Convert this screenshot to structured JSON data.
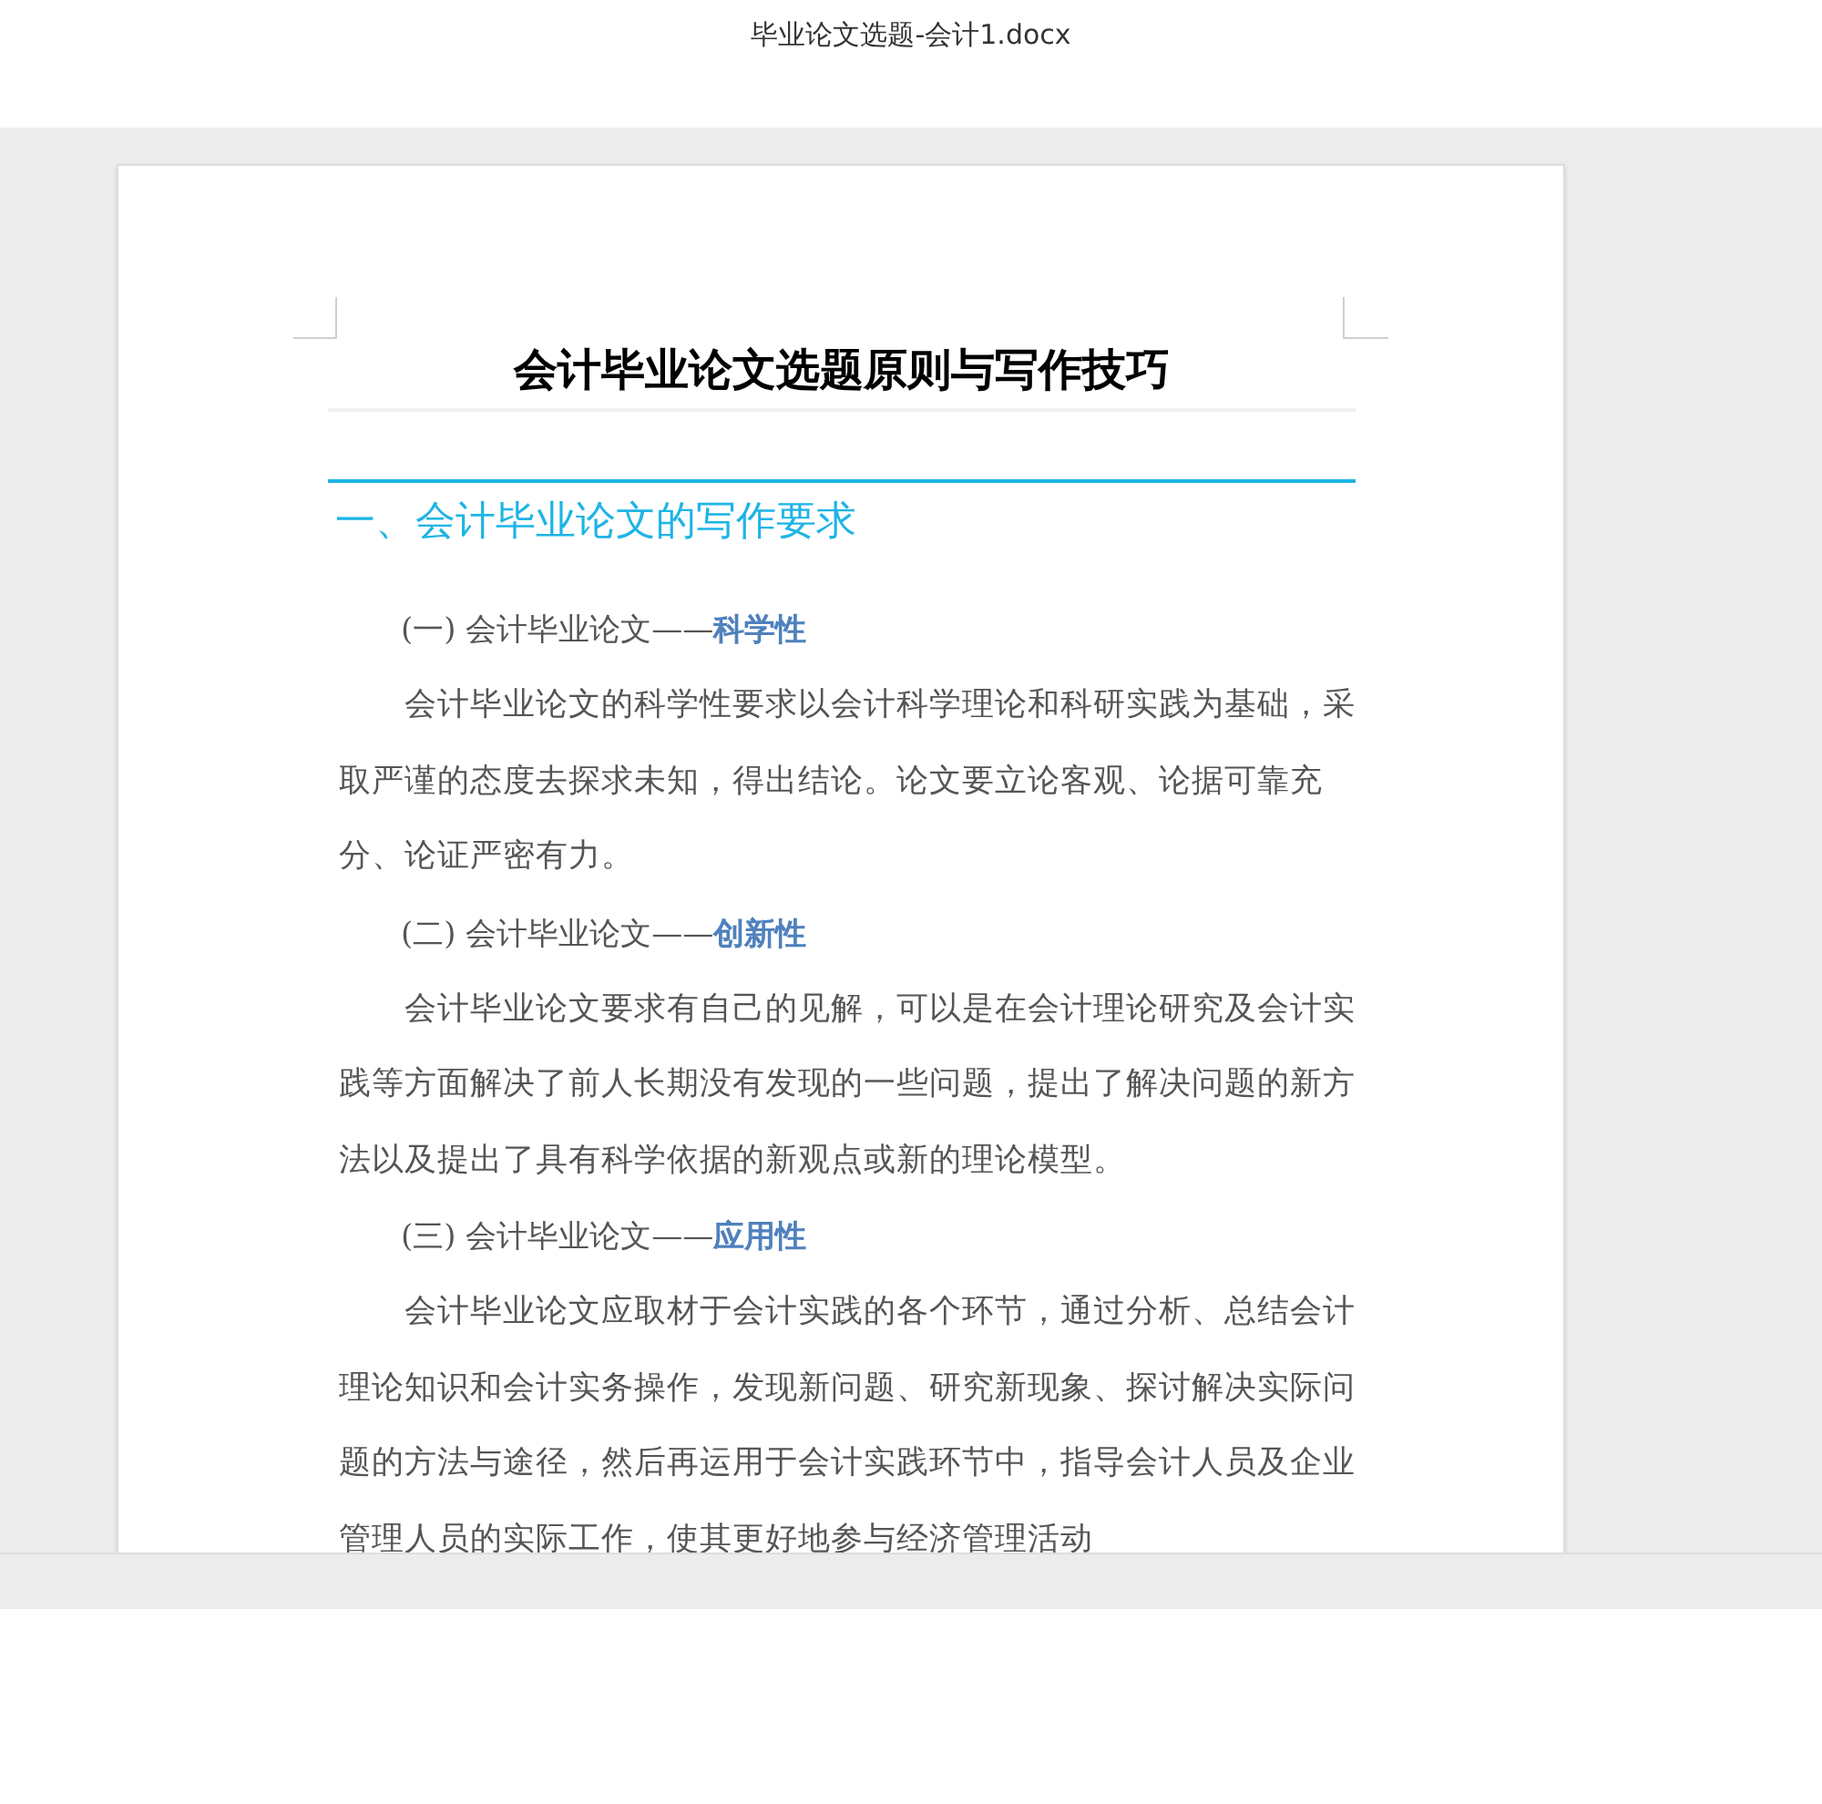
{
  "window": {
    "title": "毕业论文选题-会计1.docx"
  },
  "document": {
    "title": "会计毕业论文选题原则与写作技巧",
    "heading": "一、会计毕业论文的写作要求",
    "blocks": [
      {
        "kind": "subheading",
        "text": "(一) 会计毕业论文——**科学性**"
      },
      {
        "kind": "paragraph",
        "text": "会计毕业论文的科学性要求以会计科学理论和科研实践为基础，采取严谨的态度去探求未知，得出结论。论文要立论客观、论据可靠充分、论证严密有力。"
      },
      {
        "kind": "subheading",
        "text": "(二) 会计毕业论文——**创新性**"
      },
      {
        "kind": "paragraph",
        "text": "会计毕业论文要求有自己的见解，可以是在会计理论研究及会计实践等方面解决了前人长期没有发现的一些问题，提出了解决问题的新方法以及提出了具有科学依据的新观点或新的理论模型。"
      },
      {
        "kind": "subheading",
        "text": "(三) 会计毕业论文——**应用性**"
      },
      {
        "kind": "paragraph",
        "text": "会计毕业论文应取材于会计实践的各个环节，通过分析、总结会计理论知识和会计实务操作，发现新问题、研究新现象、探讨解决实际问题的方法与途径，然后再运用于会计实践环节中，指导会计人员及企业管理人员的实际工作，使其更好地参与经济管理活动"
      }
    ]
  }
}
